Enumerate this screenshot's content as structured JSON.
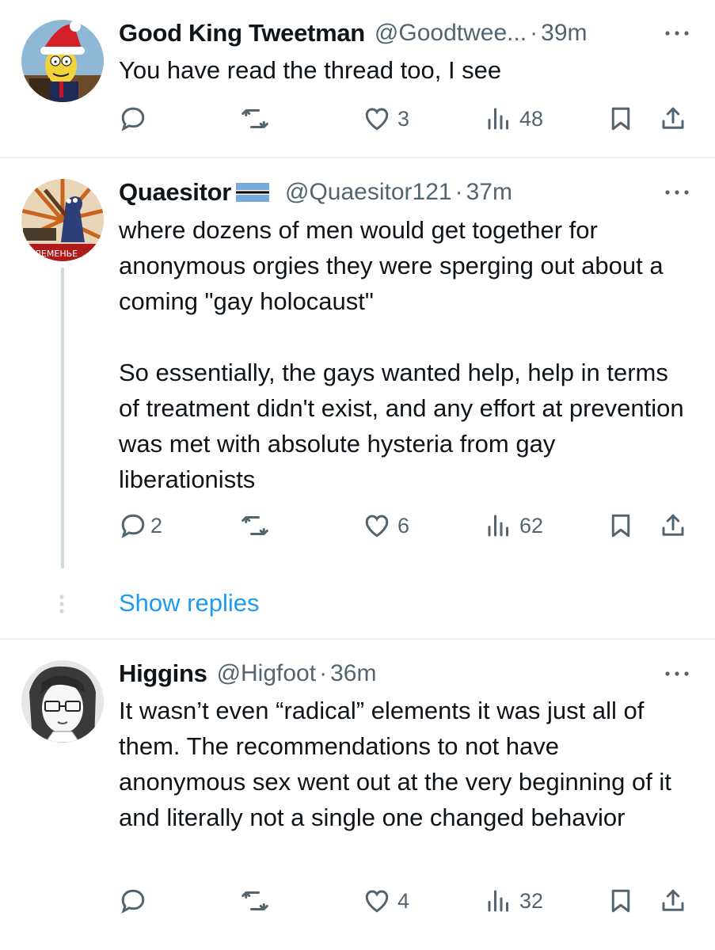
{
  "tweets": [
    {
      "name": "Good King Tweetman",
      "handle": "@Goodtwee...",
      "separator": "·",
      "time": "39m",
      "text": [
        "You have read the thread too, I see"
      ],
      "reply_count": "",
      "retweet_count": "",
      "like_count": "3",
      "view_count": "48",
      "avatar_icon": "santa-hat-cartoon-avatar"
    },
    {
      "name": "Quaesitor",
      "handle": "@Quaesitor121",
      "separator": "·",
      "time": "37m",
      "text": [
        "where dozens of men would get together for anonymous orgies they were sperging out about a coming \"gay holocaust\"",
        "So essentially, the gays wanted help, help in terms of treatment didn't exist, and any effort at prevention was met with absolute hysteria from gay liberationists"
      ],
      "reply_count": "2",
      "retweet_count": "",
      "like_count": "6",
      "view_count": "62",
      "avatar_icon": "propaganda-poster-avatar",
      "flag_icon": "botswana-flag-icon"
    },
    {
      "name": "Higgins",
      "handle": "@Higfoot",
      "separator": "·",
      "time": "36m",
      "text": [
        "It wasn’t even “radical” elements it was just all of them. The recommendations to not have anonymous sex went out at the very beginning of it and literally not a single one changed behavior"
      ],
      "reply_count": "",
      "retweet_count": "",
      "like_count": "4",
      "view_count": "32",
      "avatar_icon": "manga-glasses-avatar"
    }
  ],
  "show_replies_label": "Show replies",
  "colors": {
    "text": "#0f1419",
    "secondary": "#536471",
    "accent": "#1d9bf0",
    "divider": "#eff3f4",
    "thread_line": "#cfd9de"
  }
}
